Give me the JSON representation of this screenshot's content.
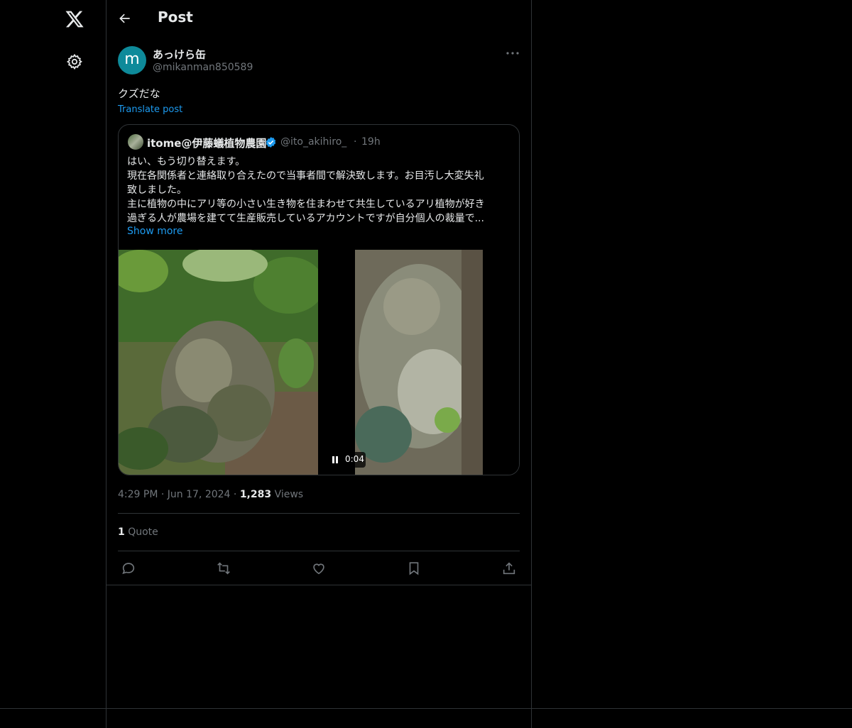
{
  "header": {
    "title": "Post"
  },
  "post": {
    "avatar_letter": "m",
    "display_name": "あっけら缶",
    "handle": "@mikanman850589",
    "text": "クズだな",
    "translate_label": "Translate post",
    "time": "4:29 PM",
    "date": "Jun 17, 2024",
    "views_count": "1,283",
    "views_label": "Views",
    "quote_count": "1",
    "quote_label": "Quote"
  },
  "quoted": {
    "display_name": "itome@伊藤蟻植物農園",
    "handle": "@ito_akihiro_",
    "separator": "·",
    "time": "19h",
    "lines": [
      "はい、もう切り替えます。",
      "現在各関係者と連絡取り合えたので当事者間で解決致します。お目汚し大変失礼",
      "致しました。",
      "主に植物の中にアリ等の小さい生き物を住まわせて共生しているアリ植物が好き",
      "過ぎる人が農場を建てて生産販売しているアカウントですが自分個人の裁量で..."
    ],
    "show_more": "Show more",
    "video_time": "0:04"
  },
  "icons": {
    "logo": "x-logo-icon",
    "settings": "gear-icon",
    "back": "back-arrow-icon",
    "more": "more-icon",
    "verified": "verified-badge-icon",
    "reply": "reply-icon",
    "repost": "repost-icon",
    "like": "like-icon",
    "bookmark": "bookmark-icon",
    "share": "share-icon"
  },
  "colors": {
    "accent": "#1d9bf0",
    "avatar": "#0e8a9a",
    "muted": "#71767b"
  }
}
